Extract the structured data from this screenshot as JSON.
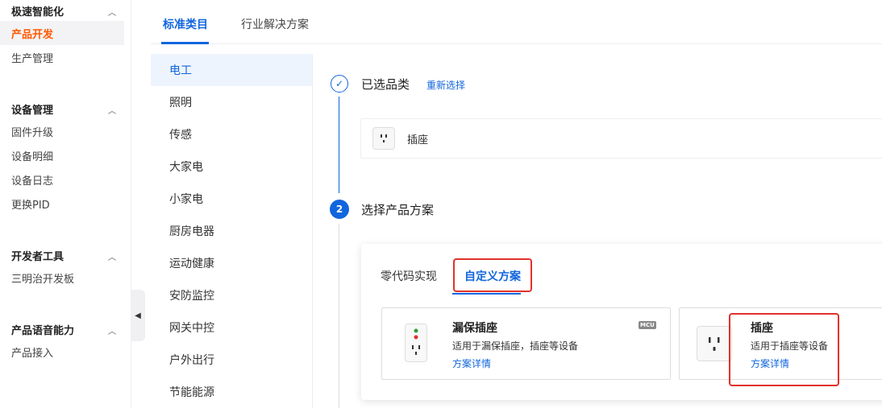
{
  "sidebar": {
    "groups": [
      {
        "title": "极速智能化",
        "items": [
          "产品开发",
          "生产管理"
        ]
      },
      {
        "title": "设备管理",
        "items": [
          "固件升级",
          "设备明细",
          "设备日志",
          "更换PID"
        ]
      },
      {
        "title": "开发者工具",
        "items": [
          "三明治开发板"
        ]
      },
      {
        "title": "产品语音能力",
        "items": [
          "产品接入"
        ]
      }
    ],
    "active_item": "产品开发"
  },
  "tabs": {
    "standard": "标准类目",
    "industry": "行业解决方案"
  },
  "categories": [
    "电工",
    "照明",
    "传感",
    "大家电",
    "小家电",
    "厨房电器",
    "运动健康",
    "安防监控",
    "网关中控",
    "户外出行",
    "节能能源"
  ],
  "step1": {
    "title": "已选品类",
    "reselect": "重新选择",
    "selected": "插座"
  },
  "step2": {
    "number": "2",
    "title": "选择产品方案"
  },
  "scheme_tabs": {
    "zero_code": "零代码实现",
    "custom": "自定义方案"
  },
  "cards": [
    {
      "title": "漏保插座",
      "desc": "适用于漏保插座，插座等设备",
      "link": "方案详情",
      "badge": "MCU"
    },
    {
      "title": "插座",
      "desc": "适用于插座等设备",
      "link": "方案详情"
    }
  ],
  "colors": {
    "accent": "#1166dd",
    "active_sidebar": "#ff5a00",
    "highlight_box": "#e0322a"
  }
}
